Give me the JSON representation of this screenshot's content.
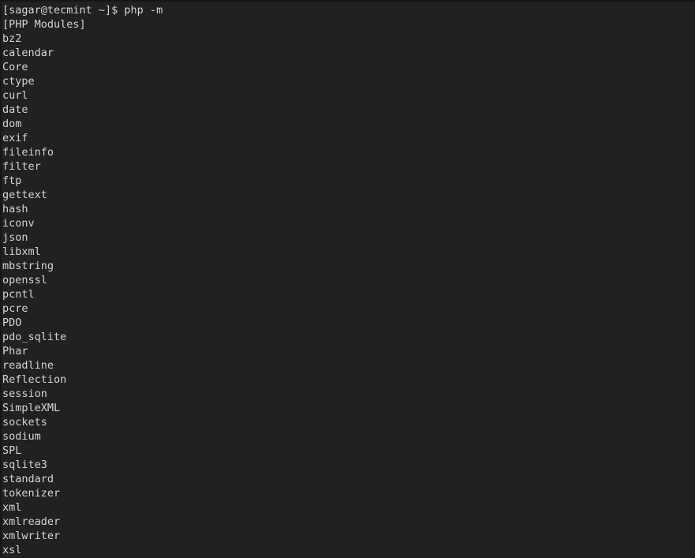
{
  "terminal": {
    "background_color": "#212121",
    "foreground_color": "#d4d4d4",
    "edge_color": "#161616",
    "prompt": "[sagar@tecmint ~]$ php -m",
    "section_header": "[PHP Modules]",
    "lines": [
      "[sagar@tecmint ~]$ php -m",
      "[PHP Modules]",
      "bz2",
      "calendar",
      "Core",
      "ctype",
      "curl",
      "date",
      "dom",
      "exif",
      "fileinfo",
      "filter",
      "ftp",
      "gettext",
      "hash",
      "iconv",
      "json",
      "libxml",
      "mbstring",
      "openssl",
      "pcntl",
      "pcre",
      "PDO",
      "pdo_sqlite",
      "Phar",
      "readline",
      "Reflection",
      "session",
      "SimpleXML",
      "sockets",
      "sodium",
      "SPL",
      "sqlite3",
      "standard",
      "tokenizer",
      "xml",
      "xmlreader",
      "xmlwriter",
      "xsl"
    ],
    "modules": [
      "bz2",
      "calendar",
      "Core",
      "ctype",
      "curl",
      "date",
      "dom",
      "exif",
      "fileinfo",
      "filter",
      "ftp",
      "gettext",
      "hash",
      "iconv",
      "json",
      "libxml",
      "mbstring",
      "openssl",
      "pcntl",
      "pcre",
      "PDO",
      "pdo_sqlite",
      "Phar",
      "readline",
      "Reflection",
      "session",
      "SimpleXML",
      "sockets",
      "sodium",
      "SPL",
      "sqlite3",
      "standard",
      "tokenizer",
      "xml",
      "xmlreader",
      "xmlwriter",
      "xsl"
    ]
  }
}
